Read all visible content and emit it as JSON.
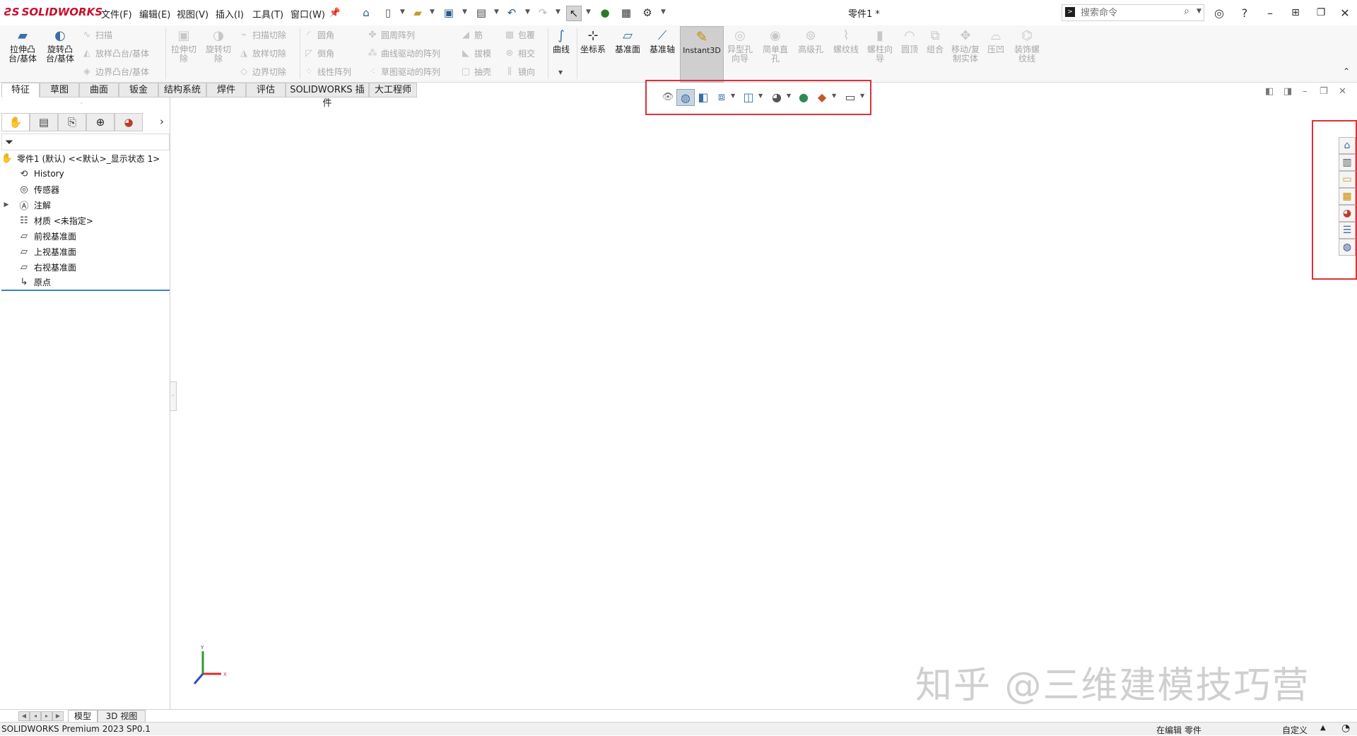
{
  "app": {
    "brand": "SOLIDWORKS",
    "document_title": "零件1 *"
  },
  "menu": [
    "文件(F)",
    "编辑(E)",
    "视图(V)",
    "插入(I)",
    "工具(T)",
    "窗口(W)"
  ],
  "search": {
    "placeholder": "搜索命令"
  },
  "command_manager": {
    "extrude_boss": "拉伸凸台/基体",
    "revolve_boss": "旋转凸台/基体",
    "sweep": "扫描",
    "loft": "放样凸台/基体",
    "boundary": "边界凸台/基体",
    "extrude_cut": "拉伸切除",
    "revolve_cut": "旋转切除",
    "sweep_cut": "扫描切除",
    "loft_cut": "放样切除",
    "boundary_cut": "边界切除",
    "fillet": "圆角",
    "chamfer": "倒角",
    "linear_pattern": "线性阵列",
    "circular_pattern": "圆周阵列",
    "curve_pattern": "曲线驱动的阵列",
    "sketch_pattern": "草图驱动的阵列",
    "rib": "筋",
    "draft": "拔模",
    "shell": "抽壳",
    "wrap": "包覆",
    "intersect": "相交",
    "mirror": "镜向",
    "curves": "曲线",
    "coord_system": "坐标系",
    "ref_plane": "基准面",
    "ref_axis": "基准轴",
    "instant3d": "Instant3D",
    "hole_wizard": "异型孔向导",
    "simple_hole": "简单直孔",
    "advanced_hole": "高级孔",
    "thread": "螺纹线",
    "stud_wizard": "螺柱向导",
    "dome": "圆顶",
    "combine": "组合",
    "move_copy": "移动/复制实体",
    "indent": "压凹",
    "cosmetic_thread": "装饰螺纹线"
  },
  "tabs": [
    "特征",
    "草图",
    "曲面",
    "钣金",
    "结构系统",
    "焊件",
    "评估",
    "SOLIDWORKS 插件",
    "大工程师"
  ],
  "feature_tree": {
    "root": "零件1 (默认) <<默认>_显示状态 1>",
    "items": [
      "History",
      "传感器",
      "注解",
      "材质 <未指定>",
      "前视基准面",
      "上视基准面",
      "右视基准面",
      "原点"
    ]
  },
  "triad": {
    "y": "Y",
    "x": "X"
  },
  "watermark": "知乎 @三维建模技巧营",
  "bottom_tabs": [
    "模型",
    "3D 视图"
  ],
  "status": {
    "product": "SOLIDWORKS Premium 2023 SP0.1",
    "editing": "在编辑 零件",
    "custom": "自定义"
  },
  "colors": {
    "brand_red": "#c8102e",
    "highlight_red": "#d9323a",
    "accent_blue": "#3f7fbf"
  }
}
